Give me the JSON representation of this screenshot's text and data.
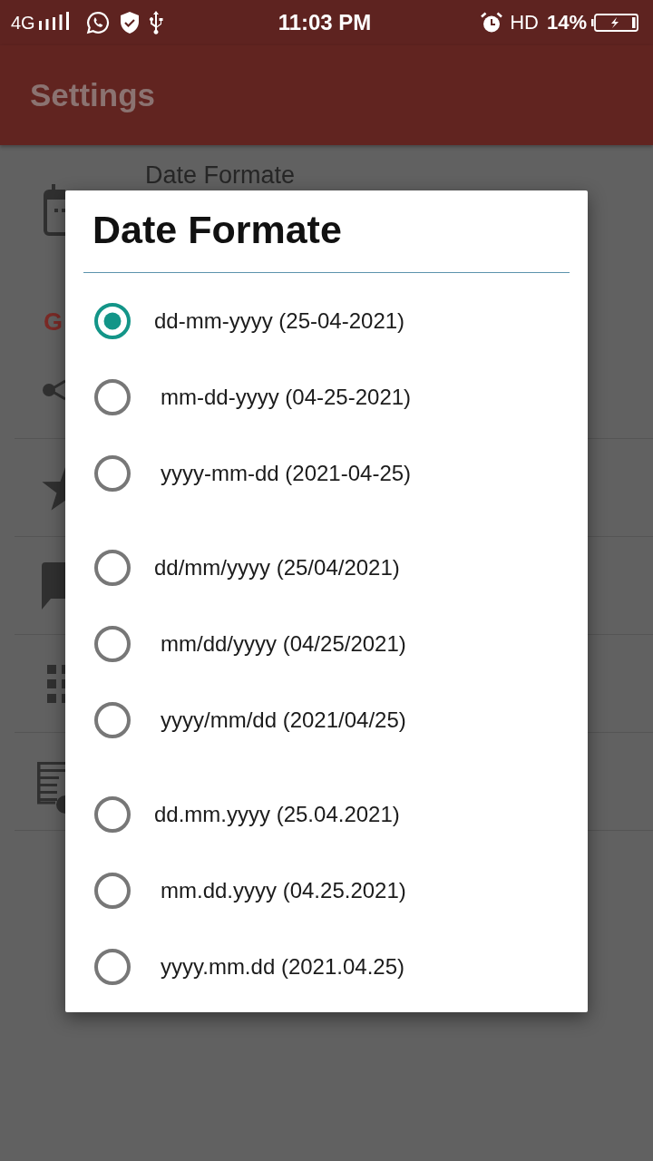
{
  "status_bar": {
    "network": "4G",
    "time": "11:03 PM",
    "hd": "HD",
    "battery": "14%"
  },
  "app_bar": {
    "title": "Settings"
  },
  "settings_page": {
    "date_format_label": "Date Formate",
    "section_header": "G"
  },
  "dialog": {
    "title": "Date Formate",
    "groups": [
      {
        "options": [
          {
            "label": "dd-mm-yyyy (25-04-2021)",
            "selected": true
          },
          {
            "label": "mm-dd-yyyy (04-25-2021)",
            "selected": false
          },
          {
            "label": "yyyy-mm-dd (2021-04-25)",
            "selected": false
          }
        ]
      },
      {
        "options": [
          {
            "label": "dd/mm/yyyy (25/04/2021)",
            "selected": false
          },
          {
            "label": "mm/dd/yyyy (04/25/2021)",
            "selected": false
          },
          {
            "label": "yyyy/mm/dd (2021/04/25)",
            "selected": false
          }
        ]
      },
      {
        "options": [
          {
            "label": "dd.mm.yyyy (25.04.2021)",
            "selected": false
          },
          {
            "label": "mm.dd.yyyy (04.25.2021)",
            "selected": false
          },
          {
            "label": "yyyy.mm.dd (2021.04.25)",
            "selected": false
          }
        ]
      }
    ]
  }
}
